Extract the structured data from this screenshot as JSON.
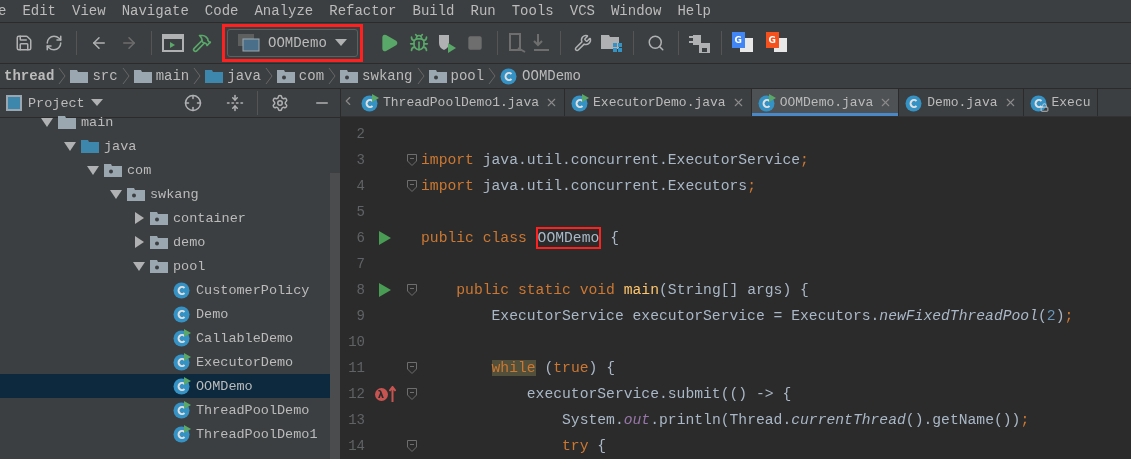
{
  "menu": [
    "e",
    "Edit",
    "View",
    "Navigate",
    "Code",
    "Analyze",
    "Refactor",
    "Build",
    "Run",
    "Tools",
    "VCS",
    "Window",
    "Help"
  ],
  "toolbar": {
    "run_config": {
      "label": "OOMDemo",
      "highlighted": true
    },
    "translate_buttons": [
      {
        "glyph": "G",
        "color": "#4285f4"
      },
      {
        "glyph": "G",
        "color": "#f4511e"
      }
    ]
  },
  "breadcrumb": [
    {
      "label": "thread",
      "kind": "module"
    },
    {
      "label": "src",
      "kind": "folder"
    },
    {
      "label": "main",
      "kind": "folder"
    },
    {
      "label": "java",
      "kind": "source"
    },
    {
      "label": "com",
      "kind": "package"
    },
    {
      "label": "swkang",
      "kind": "package"
    },
    {
      "label": "pool",
      "kind": "package"
    },
    {
      "label": "OOMDemo",
      "kind": "class"
    }
  ],
  "project_panel": {
    "title": "Project",
    "tree": [
      {
        "label": "main",
        "kind": "folder",
        "expanded": true,
        "selected": false,
        "children": [
          {
            "label": "java",
            "kind": "source",
            "expanded": true,
            "selected": false,
            "children": [
              {
                "label": "com",
                "kind": "package",
                "expanded": true,
                "selected": false,
                "children": [
                  {
                    "label": "swkang",
                    "kind": "package",
                    "expanded": true,
                    "selected": false,
                    "children": [
                      {
                        "label": "container",
                        "kind": "package",
                        "expanded": false,
                        "selected": false
                      },
                      {
                        "label": "demo",
                        "kind": "package",
                        "expanded": false,
                        "selected": false
                      },
                      {
                        "label": "pool",
                        "kind": "package",
                        "expanded": true,
                        "selected": false,
                        "children": [
                          {
                            "label": "CustomerPolicy",
                            "kind": "class",
                            "runnable": false,
                            "selected": false
                          },
                          {
                            "label": "Demo",
                            "kind": "class",
                            "runnable": false,
                            "selected": false
                          },
                          {
                            "label": "CallableDemo",
                            "kind": "class",
                            "runnable": true,
                            "selected": false
                          },
                          {
                            "label": "ExecutorDemo",
                            "kind": "class",
                            "runnable": true,
                            "selected": false
                          },
                          {
                            "label": "OOMDemo",
                            "kind": "class",
                            "runnable": true,
                            "selected": true
                          },
                          {
                            "label": "ThreadPoolDemo",
                            "kind": "class",
                            "runnable": true,
                            "selected": false
                          },
                          {
                            "label": "ThreadPoolDemo1",
                            "kind": "class",
                            "runnable": true,
                            "selected": false
                          }
                        ]
                      }
                    ]
                  }
                ]
              }
            ]
          }
        ]
      }
    ]
  },
  "editor_tabs": [
    {
      "label": "ThreadPoolDemo1.java",
      "runnable": true,
      "locked": false,
      "selected": false,
      "closable": true
    },
    {
      "label": "ExecutorDemo.java",
      "runnable": true,
      "locked": false,
      "selected": false,
      "closable": true
    },
    {
      "label": "OOMDemo.java",
      "runnable": true,
      "locked": false,
      "selected": true,
      "closable": true
    },
    {
      "label": "Demo.java",
      "runnable": false,
      "locked": false,
      "selected": false,
      "closable": true
    },
    {
      "label": "Execu",
      "runnable": false,
      "locked": true,
      "selected": false,
      "closable": false
    }
  ],
  "code": [
    {
      "number": "2",
      "run": false,
      "fold": false
    },
    {
      "number": "3",
      "run": false,
      "fold": true,
      "tokens": [
        {
          "kind": "kw",
          "text": "import "
        },
        {
          "kind": "plain",
          "text": "java.util.concurrent.ExecutorService"
        },
        {
          "kind": "kw",
          "text": ";"
        }
      ]
    },
    {
      "number": "4",
      "run": false,
      "fold": true,
      "tokens": [
        {
          "kind": "kw",
          "text": "import "
        },
        {
          "kind": "plain",
          "text": "java.util.concurrent.Executors"
        },
        {
          "kind": "kw",
          "text": ";"
        }
      ]
    },
    {
      "number": "5",
      "run": false,
      "fold": false
    },
    {
      "number": "6",
      "run": true,
      "fold": false,
      "tokens": [
        {
          "kind": "kw",
          "text": "public class "
        },
        {
          "kind": "plain",
          "text": "OOMDemo",
          "highlighted": true
        },
        {
          "kind": "plain",
          "text": " {"
        }
      ]
    },
    {
      "number": "7",
      "run": false,
      "fold": false
    },
    {
      "number": "8",
      "run": true,
      "fold": true,
      "tokens": [
        {
          "kind": "kw",
          "text": "    public static void "
        },
        {
          "kind": "fn",
          "text": "main"
        },
        {
          "kind": "plain",
          "text": "(String[] args) {"
        }
      ]
    },
    {
      "number": "9",
      "run": false,
      "fold": false,
      "tokens": [
        {
          "kind": "plain",
          "text": "        ExecutorService executorService = Executors."
        },
        {
          "kind": "italic",
          "text": "newFixedThreadPool"
        },
        {
          "kind": "plain",
          "text": "("
        },
        {
          "kind": "num",
          "text": "2"
        },
        {
          "kind": "plain",
          "text": ")"
        },
        {
          "kind": "kw",
          "text": ";"
        }
      ]
    },
    {
      "number": "10",
      "run": false,
      "fold": false
    },
    {
      "number": "11",
      "run": false,
      "fold": true,
      "tokens": [
        {
          "kind": "kw-mark",
          "text": "        while"
        },
        {
          "kind": "plain",
          "text": " ("
        },
        {
          "kind": "kw",
          "text": "true"
        },
        {
          "kind": "plain",
          "text": ") {"
        }
      ]
    },
    {
      "number": "12",
      "run": false,
      "fold": true,
      "lambda_badge": "λ",
      "tokens": [
        {
          "kind": "plain",
          "text": "            executorService.submit(() -> {"
        }
      ]
    },
    {
      "number": "13",
      "run": false,
      "fold": false,
      "tokens": [
        {
          "kind": "plain",
          "text": "                System."
        },
        {
          "kind": "field",
          "text": "out"
        },
        {
          "kind": "plain",
          "text": ".println(Thread."
        },
        {
          "kind": "italic",
          "text": "currentThread"
        },
        {
          "kind": "plain",
          "text": "().getName())"
        },
        {
          "kind": "kw",
          "text": ";"
        }
      ]
    },
    {
      "number": "14",
      "run": false,
      "fold": true,
      "tokens": [
        {
          "kind": "kw",
          "text": "                try"
        },
        {
          "kind": "plain",
          "text": " {"
        }
      ]
    }
  ]
}
